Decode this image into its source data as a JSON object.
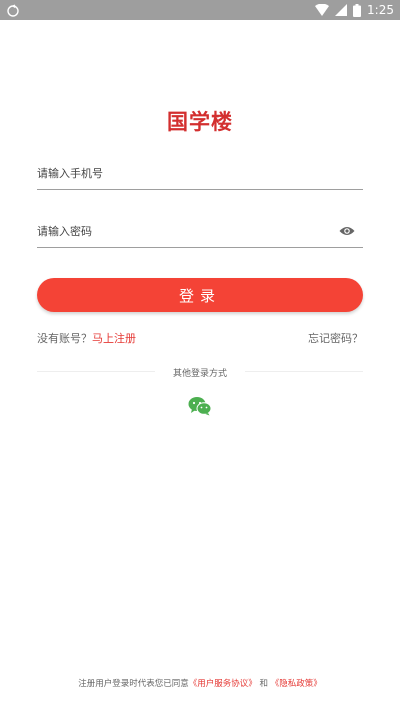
{
  "status_bar": {
    "time": "1:25"
  },
  "logo": {
    "text": "国学楼"
  },
  "form": {
    "phone_placeholder": "请输入手机号",
    "password_placeholder": "请输入密码",
    "login_label": "登录"
  },
  "links": {
    "no_account": "没有账号？",
    "register": "马上注册",
    "forgot": "忘记密码？"
  },
  "other_login": {
    "label": "其他登录方式"
  },
  "footer": {
    "prefix": "注册用户登录时代表您已同意",
    "terms": "《用户服务协议》",
    "and": "和",
    "privacy": "《隐私政策》"
  },
  "colors": {
    "accent": "#f44336",
    "link": "#e53935",
    "wechat": "#4caf50"
  }
}
